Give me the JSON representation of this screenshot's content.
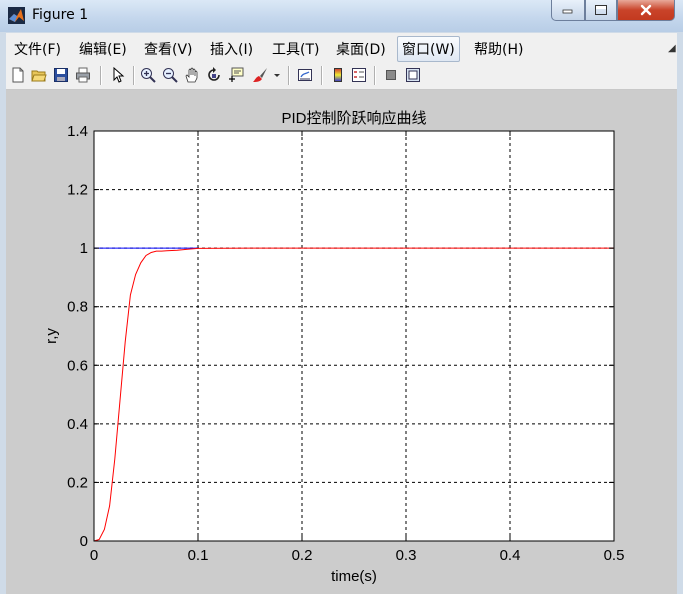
{
  "window": {
    "title": "Figure 1",
    "min_icon": "minimize-icon",
    "max_icon": "maximize-icon",
    "close_icon": "close-icon"
  },
  "menu": {
    "items": [
      "文件(F)",
      "编辑(E)",
      "查看(V)",
      "插入(I)",
      "工具(T)",
      "桌面(D)",
      "窗口(W)",
      "帮助(H)"
    ],
    "active": "窗口(W)"
  },
  "toolbar": {
    "icons": [
      "new-figure-icon",
      "open-file-icon",
      "save-icon",
      "print-icon",
      "edit-plot-arrow-icon",
      "zoom-in-icon",
      "zoom-out-icon",
      "pan-hand-icon",
      "rotate-3d-icon",
      "data-cursor-icon",
      "brush-icon",
      "brush-dropdown-icon",
      "link-plot-icon",
      "colorbar-icon",
      "legend-icon",
      "hide-plot-tools-icon",
      "show-plot-tools-icon"
    ]
  },
  "colors": {
    "figure_bg": "#cccccc",
    "axes_bg": "#ffffff",
    "reference_line": "#0000ff",
    "response_line": "#ff0000"
  },
  "chart_data": {
    "type": "line",
    "title": "PID控制阶跃响应曲线",
    "xlabel": "time(s)",
    "ylabel": "r,y",
    "xlim": [
      0,
      0.5
    ],
    "ylim": [
      0,
      1.4
    ],
    "xticks": [
      0,
      0.1,
      0.2,
      0.3,
      0.4,
      0.5
    ],
    "xtick_labels": [
      "0",
      "0.1",
      "0.2",
      "0.3",
      "0.4",
      "0.5"
    ],
    "yticks": [
      0,
      0.2,
      0.4,
      0.6,
      0.8,
      1,
      1.2,
      1.4
    ],
    "ytick_labels": [
      "0",
      "0.2",
      "0.4",
      "0.6",
      "0.8",
      "1",
      "1.2",
      "1.4"
    ],
    "grid": true,
    "series": [
      {
        "color": "#0000ff",
        "x": [
          0,
          0.1
        ],
        "y": [
          1,
          1
        ]
      },
      {
        "color": "#ff0000",
        "x": [
          0,
          0.005,
          0.01,
          0.015,
          0.02,
          0.025,
          0.03,
          0.035,
          0.04,
          0.045,
          0.05,
          0.055,
          0.06,
          0.065,
          0.07,
          0.08,
          0.09,
          0.1,
          0.15,
          0.2,
          0.3,
          0.4,
          0.5
        ],
        "y": [
          0,
          0.005,
          0.04,
          0.12,
          0.28,
          0.48,
          0.68,
          0.84,
          0.91,
          0.95,
          0.975,
          0.985,
          0.99,
          0.99,
          0.991,
          0.993,
          0.996,
          0.999,
          1,
          1,
          1,
          1,
          1
        ]
      }
    ]
  }
}
